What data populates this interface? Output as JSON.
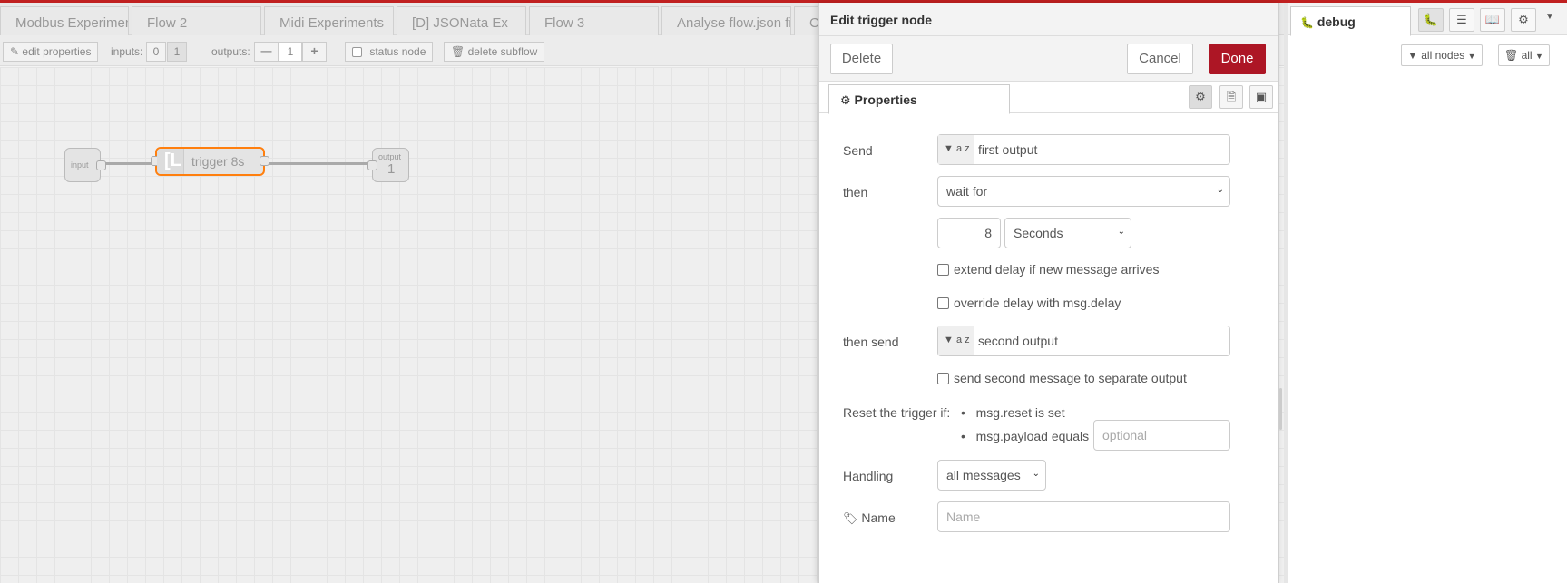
{
  "workspace": {
    "tabs": [
      {
        "label": "Modbus Experiment"
      },
      {
        "label": "Flow 2"
      },
      {
        "label": "Midi Experiments"
      },
      {
        "label": "[D] JSONata Ex"
      },
      {
        "label": "Flow 3"
      },
      {
        "label": "Analyse flow.json fil"
      },
      {
        "label": "C"
      }
    ],
    "subflow_bar": {
      "edit_properties": "edit properties",
      "inputs_label": "inputs:",
      "input_opt_0": "0",
      "input_opt_1": "1",
      "outputs_label": "outputs:",
      "outputs_value": "1",
      "status_node": "status node",
      "delete_subflow": "delete subflow"
    },
    "nodes": {
      "input": "input",
      "trigger": "trigger 8s",
      "output_label": "output",
      "output_number": "1"
    }
  },
  "editor": {
    "title": "Edit trigger node",
    "delete": "Delete",
    "cancel": "Cancel",
    "done": "Done",
    "properties_tab": "Properties",
    "send_label": "Send",
    "send_value": "first output",
    "typed_type_icon": "a z",
    "then_label": "then",
    "then_value": "wait for",
    "delay_value": "8",
    "delay_units": "Seconds",
    "extend_delay": "extend delay if new message arrives",
    "override_delay": "override delay with msg.delay",
    "then_send_label": "then send",
    "then_send_value": "second output",
    "second_output": "send second message to separate output",
    "reset_label": "Reset the trigger if:",
    "reset_1": "msg.reset is set",
    "reset_2": "msg.payload equals",
    "reset_placeholder": "optional",
    "handling_label": "Handling",
    "handling_value": "all messages",
    "name_label": "Name",
    "name_placeholder": "Name",
    "accent": "#ad1625"
  },
  "sidebar": {
    "tab_label": "debug",
    "filter_nodes": "all nodes",
    "filter_all": "all"
  }
}
